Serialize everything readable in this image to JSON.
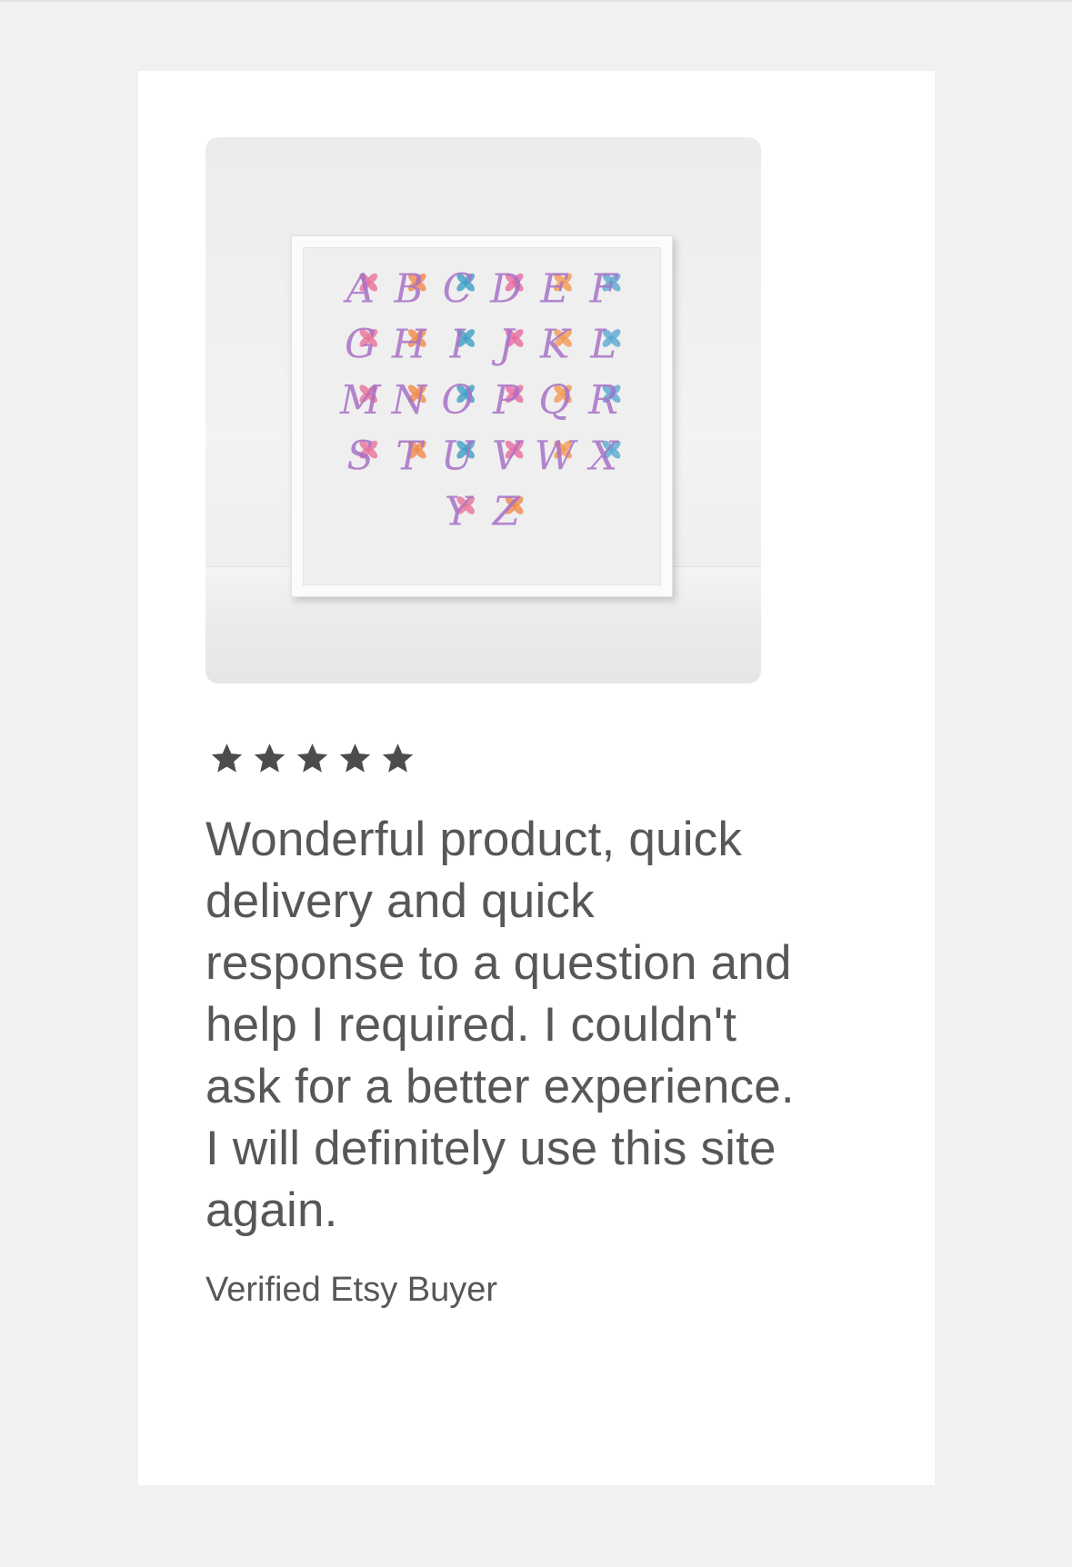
{
  "colors": {
    "page_background": "#f1f1f1",
    "card_background": "#ffffff",
    "text": "#575757",
    "star": "#4c4c4c"
  },
  "product_image": {
    "icon": "framed-alphabet-cross-stitch-image",
    "letters": [
      "A",
      "B",
      "C",
      "D",
      "E",
      "F",
      "G",
      "H",
      "I",
      "J",
      "K",
      "L",
      "M",
      "N",
      "O",
      "P",
      "Q",
      "R",
      "S",
      "T",
      "U",
      "V",
      "W",
      "X",
      "Y",
      "Z"
    ]
  },
  "review": {
    "rating": 5,
    "rating_max": 5,
    "text": "Wonderful product, quick\ndelivery and quick\nresponse to a question and\nhelp I required.  I couldn't\nask for a better experience.\nI will definitely use this site\nagain.",
    "author": "Verified Etsy Buyer"
  }
}
